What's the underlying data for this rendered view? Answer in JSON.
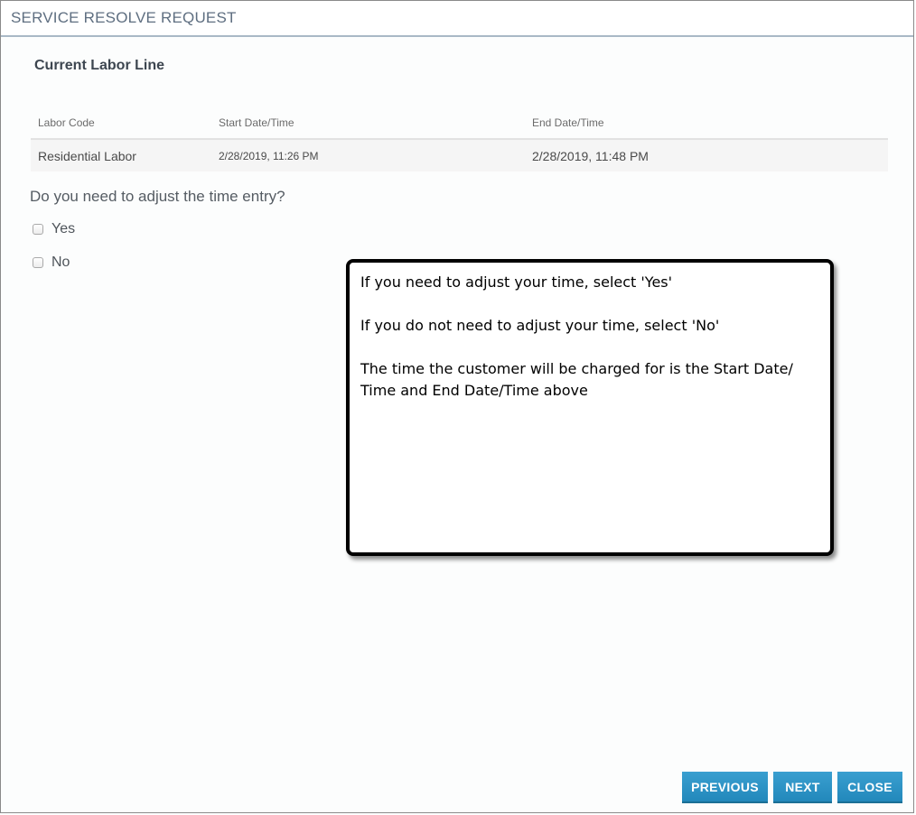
{
  "dialog": {
    "title": "SERVICE RESOLVE REQUEST"
  },
  "labor": {
    "section_title": "Current Labor Line",
    "columns": [
      "Labor Code",
      "Start Date/Time",
      "End Date/Time"
    ],
    "rows": [
      [
        "Residential Labor",
        "2/28/2019, 11:26 PM",
        "2/28/2019, 11:48 PM"
      ]
    ]
  },
  "adjust": {
    "question": "Do you need to adjust the time entry?",
    "options": [
      {
        "label": "Yes",
        "checked": false
      },
      {
        "label": "No",
        "checked": false
      }
    ]
  },
  "callout": {
    "lines": [
      "If you need to adjust your time, select 'Yes'",
      "If you do not need to adjust your time, select 'No'",
      "The time the customer will be charged for is the Start Date/ Time and End Date/Time above"
    ]
  },
  "buttons": {
    "previous": "PREVIOUS",
    "next": "NEXT",
    "close": "CLOSE"
  },
  "colors": {
    "button": "#2a8fc3",
    "header_text": "#5e6e80",
    "header_border": "#a9b8c6"
  }
}
